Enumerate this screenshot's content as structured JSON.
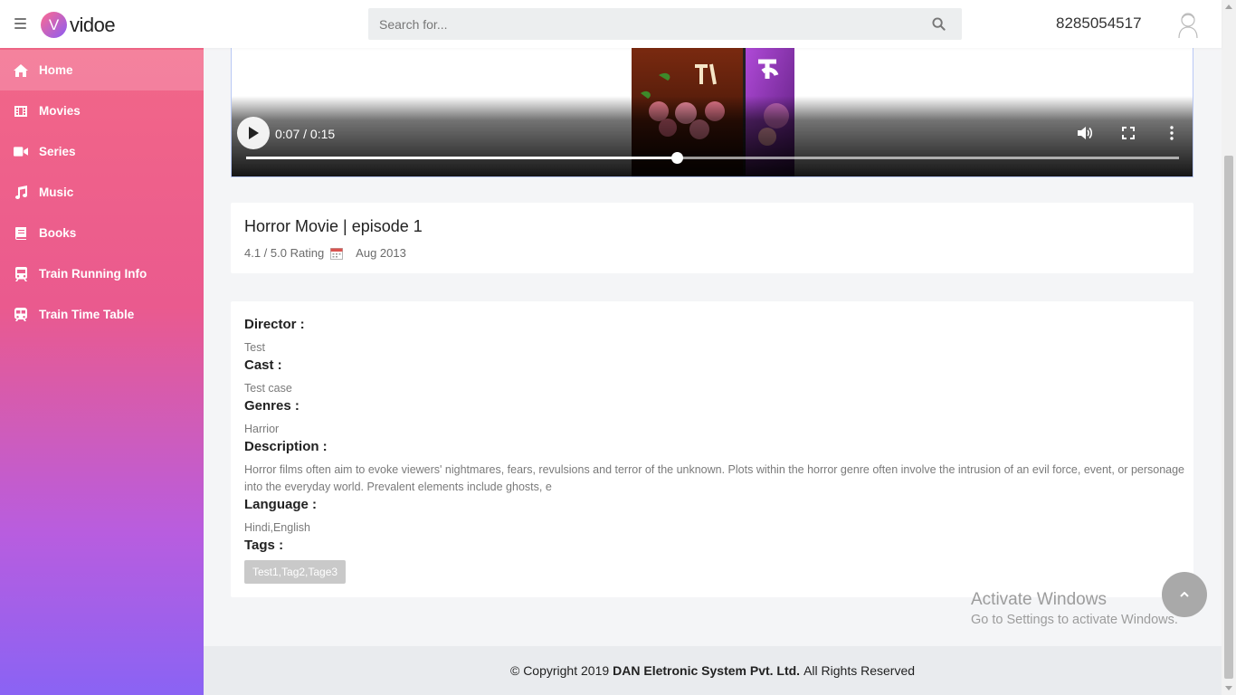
{
  "header": {
    "logo_letter": "V",
    "logo_text": "vidoe",
    "search_placeholder": "Search for...",
    "phone": "8285054517"
  },
  "sidebar": {
    "items": [
      {
        "label": "Home",
        "icon": "home-icon"
      },
      {
        "label": "Movies",
        "icon": "film-icon"
      },
      {
        "label": "Series",
        "icon": "video-camera-icon"
      },
      {
        "label": "Music",
        "icon": "music-icon"
      },
      {
        "label": "Books",
        "icon": "book-icon"
      },
      {
        "label": "Train Running Info",
        "icon": "train-icon"
      },
      {
        "label": "Train Time Table",
        "icon": "subway-icon"
      }
    ],
    "active_index": 0
  },
  "video": {
    "time": "0:07 / 0:15",
    "progress": 0.4615
  },
  "movie": {
    "title": "Horror Movie | episode 1",
    "rating": "4.1 / 5.0 Rating",
    "date": "Aug 2013"
  },
  "details": {
    "director_label": "Director :",
    "director": "Test",
    "cast_label": "Cast :",
    "cast": "Test case",
    "genres_label": "Genres :",
    "genres": "Harrior",
    "description_label": "Description :",
    "description": "Horror films often aim to evoke viewers' nightmares, fears, revulsions and terror of the unknown. Plots within the horror genre often involve the intrusion of an evil force, event, or personage into the everyday world. Prevalent elements include ghosts, e",
    "language_label": "Language :",
    "language": "Hindi,English",
    "tags_label": "Tags :",
    "tags": "Test1,Tag2,Tage3"
  },
  "watermark": {
    "line1": "Activate Windows",
    "line2": "Go to Settings to activate Windows."
  },
  "footer": {
    "prefix": "© Copyright 2019",
    "company": "DAN Eletronic System Pvt. Ltd.",
    "suffix": "All Rights Reserved"
  },
  "colors": {
    "sidebar_top": "#f26788",
    "sidebar_bottom": "#8a63f4",
    "accent": "#e95b8f"
  }
}
